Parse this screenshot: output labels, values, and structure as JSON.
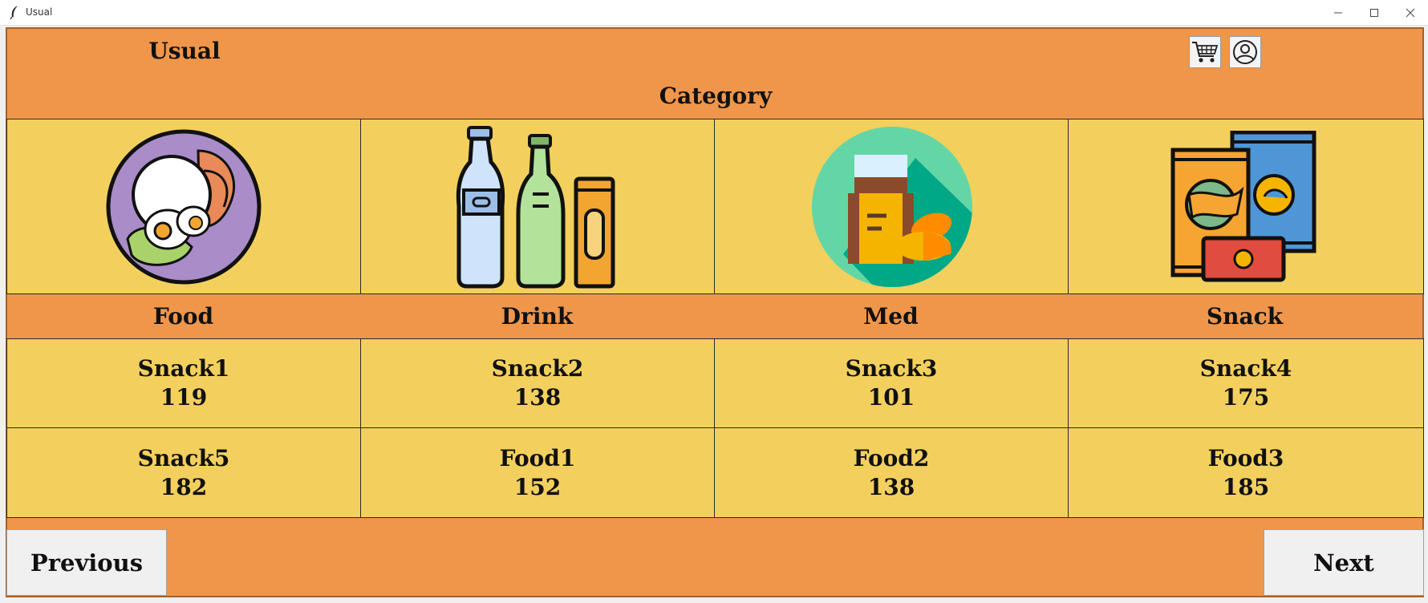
{
  "window": {
    "title": "Usual"
  },
  "header": {
    "title": "Usual",
    "cart_icon": "cart-icon",
    "profile_icon": "user-profile-icon"
  },
  "category": {
    "title": "Category",
    "items": [
      {
        "label": "Food",
        "icon": "rice-bowl-icon"
      },
      {
        "label": "Drink",
        "icon": "bottles-icon"
      },
      {
        "label": "Med",
        "icon": "medicine-icon"
      },
      {
        "label": "Snack",
        "icon": "snack-packs-icon"
      }
    ]
  },
  "products": [
    {
      "name": "Snack1",
      "price": "119"
    },
    {
      "name": "Snack2",
      "price": "138"
    },
    {
      "name": "Snack3",
      "price": "101"
    },
    {
      "name": "Snack4",
      "price": "175"
    },
    {
      "name": "Snack5",
      "price": "182"
    },
    {
      "name": "Food1",
      "price": "152"
    },
    {
      "name": "Food2",
      "price": "138"
    },
    {
      "name": "Food3",
      "price": "185"
    }
  ],
  "nav": {
    "previous": "Previous",
    "next": "Next"
  },
  "colors": {
    "header_bg": "#ef964b",
    "tile_bg": "#f3d05e"
  }
}
